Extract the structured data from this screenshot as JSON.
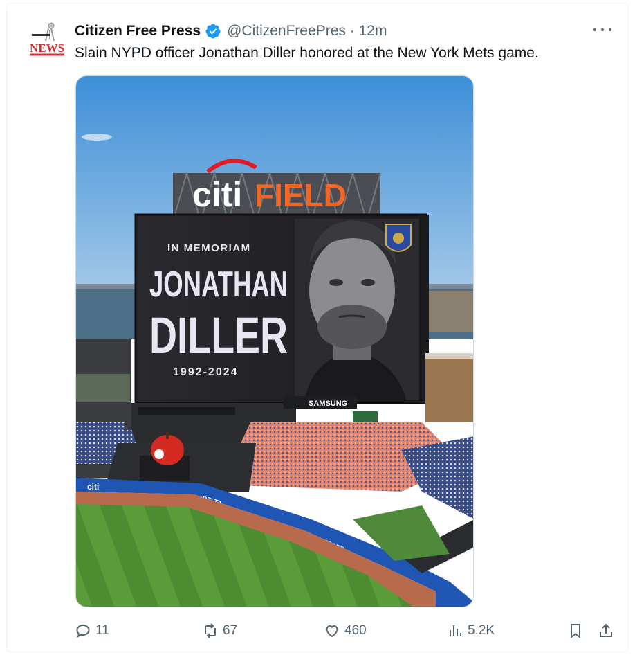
{
  "tweet": {
    "author_name": "Citizen Free Press",
    "handle_time": "@CitizenFreePres · 12m",
    "text": "Slain NYPD officer Jonathan Diller honored at the New York Mets game.",
    "verified_color": "#1d9bf0",
    "avatar_text": "NEWS"
  },
  "media": {
    "sign_left": "citi",
    "sign_right": "FIELD",
    "memoriam": "IN MEMORIAM",
    "first_name": "JONATHAN",
    "last_name": "DILLER",
    "years": "1992-2024",
    "sponsor": "SAMSUNG",
    "sign_left_color": "#ffffff",
    "sign_right_color": "#f26522",
    "citi_banner": "citi",
    "delta_banner": "DELTA",
    "caesars_banner": "CAESARS"
  },
  "actions": {
    "replies": "11",
    "reposts": "67",
    "likes": "460",
    "views": "5.2K"
  },
  "icons": [
    "more-icon",
    "verified-icon",
    "reply-icon",
    "repost-icon",
    "like-icon",
    "views-icon",
    "bookmark-icon",
    "share-icon"
  ]
}
